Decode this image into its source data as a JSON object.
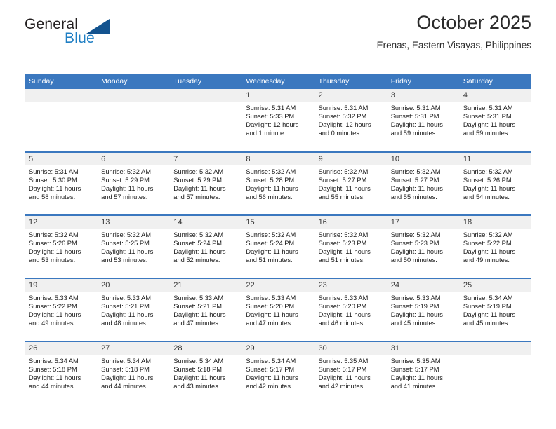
{
  "brand": {
    "name_top": "General",
    "name_bottom": "Blue",
    "accent_color": "#1f7fc4",
    "triangle_color": "#13538f",
    "triangle_icon": "triangle-icon"
  },
  "header": {
    "title": "October 2025",
    "subtitle": "Erenas, Eastern Visayas, Philippines"
  },
  "calendar": {
    "header_bg": "#3b78bf",
    "header_text_color": "#ffffff",
    "daynum_bg": "#f0f0f0",
    "weekday_headers": [
      "Sunday",
      "Monday",
      "Tuesday",
      "Wednesday",
      "Thursday",
      "Friday",
      "Saturday"
    ],
    "weeks": [
      [
        {
          "day": "",
          "sunrise": "",
          "sunset": "",
          "daylight_line1": "",
          "daylight_line2": "",
          "empty": true
        },
        {
          "day": "",
          "sunrise": "",
          "sunset": "",
          "daylight_line1": "",
          "daylight_line2": "",
          "empty": true
        },
        {
          "day": "",
          "sunrise": "",
          "sunset": "",
          "daylight_line1": "",
          "daylight_line2": "",
          "empty": true
        },
        {
          "day": "1",
          "sunrise": "Sunrise: 5:31 AM",
          "sunset": "Sunset: 5:33 PM",
          "daylight_line1": "Daylight: 12 hours",
          "daylight_line2": "and 1 minute.",
          "empty": false
        },
        {
          "day": "2",
          "sunrise": "Sunrise: 5:31 AM",
          "sunset": "Sunset: 5:32 PM",
          "daylight_line1": "Daylight: 12 hours",
          "daylight_line2": "and 0 minutes.",
          "empty": false
        },
        {
          "day": "3",
          "sunrise": "Sunrise: 5:31 AM",
          "sunset": "Sunset: 5:31 PM",
          "daylight_line1": "Daylight: 11 hours",
          "daylight_line2": "and 59 minutes.",
          "empty": false
        },
        {
          "day": "4",
          "sunrise": "Sunrise: 5:31 AM",
          "sunset": "Sunset: 5:31 PM",
          "daylight_line1": "Daylight: 11 hours",
          "daylight_line2": "and 59 minutes.",
          "empty": false
        }
      ],
      [
        {
          "day": "5",
          "sunrise": "Sunrise: 5:31 AM",
          "sunset": "Sunset: 5:30 PM",
          "daylight_line1": "Daylight: 11 hours",
          "daylight_line2": "and 58 minutes.",
          "empty": false
        },
        {
          "day": "6",
          "sunrise": "Sunrise: 5:32 AM",
          "sunset": "Sunset: 5:29 PM",
          "daylight_line1": "Daylight: 11 hours",
          "daylight_line2": "and 57 minutes.",
          "empty": false
        },
        {
          "day": "7",
          "sunrise": "Sunrise: 5:32 AM",
          "sunset": "Sunset: 5:29 PM",
          "daylight_line1": "Daylight: 11 hours",
          "daylight_line2": "and 57 minutes.",
          "empty": false
        },
        {
          "day": "8",
          "sunrise": "Sunrise: 5:32 AM",
          "sunset": "Sunset: 5:28 PM",
          "daylight_line1": "Daylight: 11 hours",
          "daylight_line2": "and 56 minutes.",
          "empty": false
        },
        {
          "day": "9",
          "sunrise": "Sunrise: 5:32 AM",
          "sunset": "Sunset: 5:27 PM",
          "daylight_line1": "Daylight: 11 hours",
          "daylight_line2": "and 55 minutes.",
          "empty": false
        },
        {
          "day": "10",
          "sunrise": "Sunrise: 5:32 AM",
          "sunset": "Sunset: 5:27 PM",
          "daylight_line1": "Daylight: 11 hours",
          "daylight_line2": "and 55 minutes.",
          "empty": false
        },
        {
          "day": "11",
          "sunrise": "Sunrise: 5:32 AM",
          "sunset": "Sunset: 5:26 PM",
          "daylight_line1": "Daylight: 11 hours",
          "daylight_line2": "and 54 minutes.",
          "empty": false
        }
      ],
      [
        {
          "day": "12",
          "sunrise": "Sunrise: 5:32 AM",
          "sunset": "Sunset: 5:26 PM",
          "daylight_line1": "Daylight: 11 hours",
          "daylight_line2": "and 53 minutes.",
          "empty": false
        },
        {
          "day": "13",
          "sunrise": "Sunrise: 5:32 AM",
          "sunset": "Sunset: 5:25 PM",
          "daylight_line1": "Daylight: 11 hours",
          "daylight_line2": "and 53 minutes.",
          "empty": false
        },
        {
          "day": "14",
          "sunrise": "Sunrise: 5:32 AM",
          "sunset": "Sunset: 5:24 PM",
          "daylight_line1": "Daylight: 11 hours",
          "daylight_line2": "and 52 minutes.",
          "empty": false
        },
        {
          "day": "15",
          "sunrise": "Sunrise: 5:32 AM",
          "sunset": "Sunset: 5:24 PM",
          "daylight_line1": "Daylight: 11 hours",
          "daylight_line2": "and 51 minutes.",
          "empty": false
        },
        {
          "day": "16",
          "sunrise": "Sunrise: 5:32 AM",
          "sunset": "Sunset: 5:23 PM",
          "daylight_line1": "Daylight: 11 hours",
          "daylight_line2": "and 51 minutes.",
          "empty": false
        },
        {
          "day": "17",
          "sunrise": "Sunrise: 5:32 AM",
          "sunset": "Sunset: 5:23 PM",
          "daylight_line1": "Daylight: 11 hours",
          "daylight_line2": "and 50 minutes.",
          "empty": false
        },
        {
          "day": "18",
          "sunrise": "Sunrise: 5:32 AM",
          "sunset": "Sunset: 5:22 PM",
          "daylight_line1": "Daylight: 11 hours",
          "daylight_line2": "and 49 minutes.",
          "empty": false
        }
      ],
      [
        {
          "day": "19",
          "sunrise": "Sunrise: 5:33 AM",
          "sunset": "Sunset: 5:22 PM",
          "daylight_line1": "Daylight: 11 hours",
          "daylight_line2": "and 49 minutes.",
          "empty": false
        },
        {
          "day": "20",
          "sunrise": "Sunrise: 5:33 AM",
          "sunset": "Sunset: 5:21 PM",
          "daylight_line1": "Daylight: 11 hours",
          "daylight_line2": "and 48 minutes.",
          "empty": false
        },
        {
          "day": "21",
          "sunrise": "Sunrise: 5:33 AM",
          "sunset": "Sunset: 5:21 PM",
          "daylight_line1": "Daylight: 11 hours",
          "daylight_line2": "and 47 minutes.",
          "empty": false
        },
        {
          "day": "22",
          "sunrise": "Sunrise: 5:33 AM",
          "sunset": "Sunset: 5:20 PM",
          "daylight_line1": "Daylight: 11 hours",
          "daylight_line2": "and 47 minutes.",
          "empty": false
        },
        {
          "day": "23",
          "sunrise": "Sunrise: 5:33 AM",
          "sunset": "Sunset: 5:20 PM",
          "daylight_line1": "Daylight: 11 hours",
          "daylight_line2": "and 46 minutes.",
          "empty": false
        },
        {
          "day": "24",
          "sunrise": "Sunrise: 5:33 AM",
          "sunset": "Sunset: 5:19 PM",
          "daylight_line1": "Daylight: 11 hours",
          "daylight_line2": "and 45 minutes.",
          "empty": false
        },
        {
          "day": "25",
          "sunrise": "Sunrise: 5:34 AM",
          "sunset": "Sunset: 5:19 PM",
          "daylight_line1": "Daylight: 11 hours",
          "daylight_line2": "and 45 minutes.",
          "empty": false
        }
      ],
      [
        {
          "day": "26",
          "sunrise": "Sunrise: 5:34 AM",
          "sunset": "Sunset: 5:18 PM",
          "daylight_line1": "Daylight: 11 hours",
          "daylight_line2": "and 44 minutes.",
          "empty": false
        },
        {
          "day": "27",
          "sunrise": "Sunrise: 5:34 AM",
          "sunset": "Sunset: 5:18 PM",
          "daylight_line1": "Daylight: 11 hours",
          "daylight_line2": "and 44 minutes.",
          "empty": false
        },
        {
          "day": "28",
          "sunrise": "Sunrise: 5:34 AM",
          "sunset": "Sunset: 5:18 PM",
          "daylight_line1": "Daylight: 11 hours",
          "daylight_line2": "and 43 minutes.",
          "empty": false
        },
        {
          "day": "29",
          "sunrise": "Sunrise: 5:34 AM",
          "sunset": "Sunset: 5:17 PM",
          "daylight_line1": "Daylight: 11 hours",
          "daylight_line2": "and 42 minutes.",
          "empty": false
        },
        {
          "day": "30",
          "sunrise": "Sunrise: 5:35 AM",
          "sunset": "Sunset: 5:17 PM",
          "daylight_line1": "Daylight: 11 hours",
          "daylight_line2": "and 42 minutes.",
          "empty": false
        },
        {
          "day": "31",
          "sunrise": "Sunrise: 5:35 AM",
          "sunset": "Sunset: 5:17 PM",
          "daylight_line1": "Daylight: 11 hours",
          "daylight_line2": "and 41 minutes.",
          "empty": false
        },
        {
          "day": "",
          "sunrise": "",
          "sunset": "",
          "daylight_line1": "",
          "daylight_line2": "",
          "empty": true
        }
      ]
    ]
  }
}
